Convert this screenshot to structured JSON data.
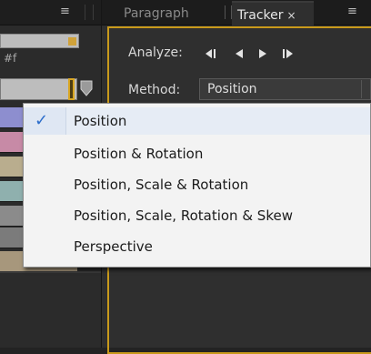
{
  "left_panel": {
    "menu_icon": "≡",
    "hash_text": "#f"
  },
  "tabs": {
    "paragraph": "Paragraph",
    "tracker": "Tracker",
    "tracker_close": "×",
    "menu_icon": "≡"
  },
  "tracker": {
    "analyze_label": "Analyze:",
    "buttons": [
      "◀I",
      "◀",
      "▶",
      "I▶"
    ],
    "method_label": "Method:",
    "method_value": "Position"
  },
  "dropdown": {
    "items": [
      {
        "label": "Position",
        "checked": true
      },
      {
        "label": "Position & Rotation",
        "checked": false
      },
      {
        "label": "Position, Scale & Rotation",
        "checked": false
      },
      {
        "label": "Position, Scale, Rotation & Skew",
        "checked": false
      },
      {
        "label": "Perspective",
        "checked": false
      }
    ],
    "check_mark": "✓"
  },
  "colors": {
    "accent_orange": "#c99a1b",
    "check_blue": "#2d6ecb",
    "swatches": [
      "#8d8ecf",
      "#c78aa6",
      "#b9ad8e",
      "#8fb0ae",
      "#8b8b8b",
      "#7b7b7b",
      "#a7977c"
    ]
  }
}
